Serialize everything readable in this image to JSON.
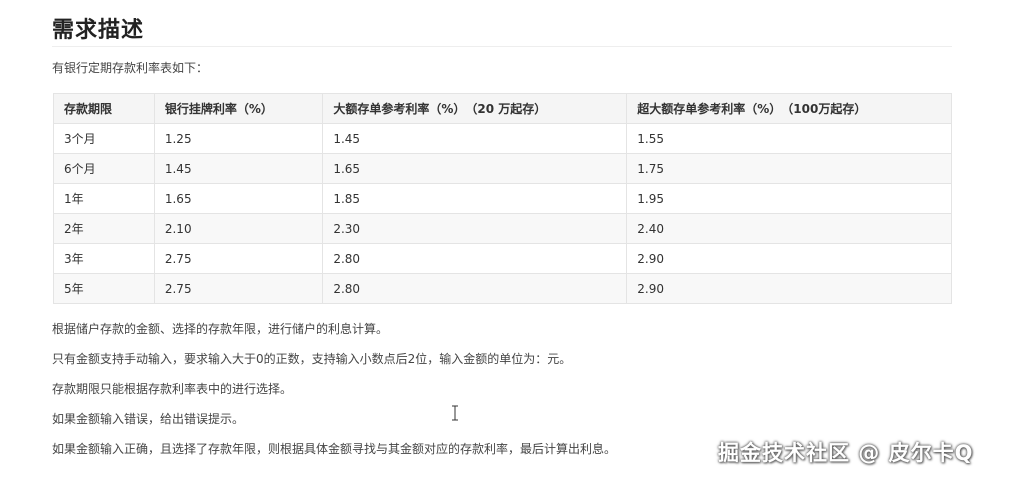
{
  "heading": "需求描述",
  "intro": "有银行定期存款利率表如下：",
  "table": {
    "headers": [
      "存款期限",
      "银行挂牌利率（%）",
      "大额存单参考利率（%）　（20 万起存）",
      "超大额存单参考利率（%）　（100万起存）"
    ],
    "rows": [
      [
        "3个月",
        "1.25",
        "1.45",
        "1.55"
      ],
      [
        "6个月",
        "1.45",
        "1.65",
        "1.75"
      ],
      [
        "1年",
        "1.65",
        "1.85",
        "1.95"
      ],
      [
        "2年",
        "2.10",
        "2.30",
        "2.40"
      ],
      [
        "3年",
        "2.75",
        "2.80",
        "2.90"
      ],
      [
        "5年",
        "2.75",
        "2.80",
        "2.90"
      ]
    ]
  },
  "paragraphs": [
    "根据储户存款的金额、选择的存款年限，进行储户的利息计算。",
    "只有金额支持手动输入，要求输入大于0的正数，支持输入小数点后2位，输入金额的单位为：元。",
    "存款期限只能根据存款利率表中的进行选择。",
    "如果金额输入错误，给出错误提示。",
    "如果金额输入正确，且选择了存款年限，则根据具体金额寻找与其金额对应的存款利率，最后计算出利息。"
  ],
  "watermark": "掘金技术社区 @ 皮尔卡Q",
  "icons": {
    "cursor": "text-cursor-icon"
  }
}
